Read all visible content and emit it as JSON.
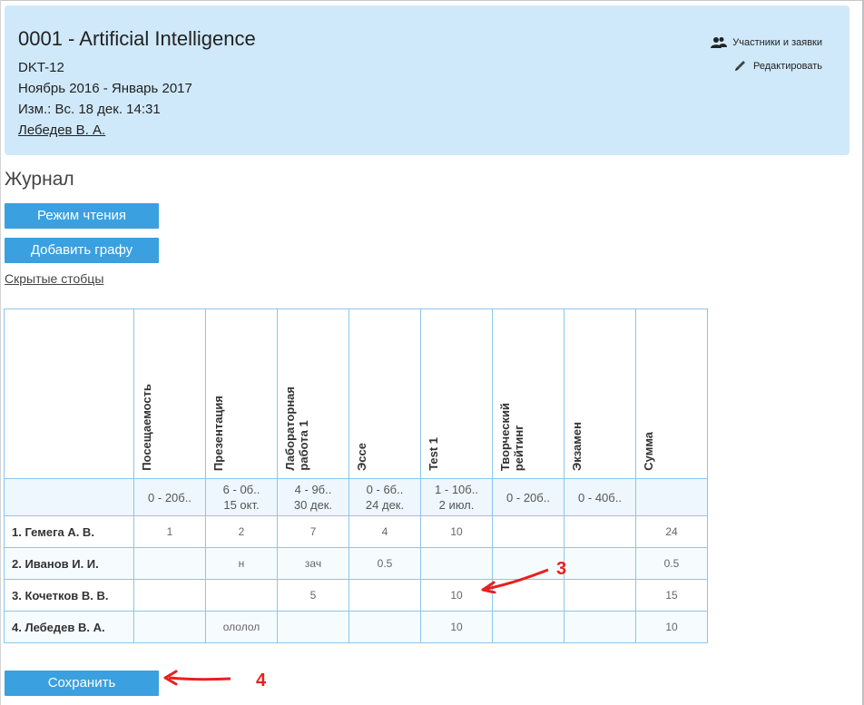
{
  "course": {
    "title": "0001 - Artificial Intelligence",
    "code": "DKT-12",
    "period": "Ноябрь 2016 - Январь 2017",
    "modified": "Изм.: Вс. 18 дек. 14:31",
    "teacher": "Лебедев В. А."
  },
  "actions": {
    "participants": "Участники и заявки",
    "edit": "Редактировать"
  },
  "journal": {
    "title": "Журнал",
    "read_mode": "Режим чтения",
    "add_column": "Добавить графу",
    "hidden_columns": "Скрытые стобцы",
    "save": "Сохранить"
  },
  "table": {
    "columns": [
      "Посещаемость",
      "Презентация",
      "Лабораторная\nработа 1",
      "Эссе",
      "Test 1",
      "Творческий\nрейтинг",
      "Экзамен",
      "Сумма"
    ],
    "ranges": [
      [
        "0 - 20б..",
        ""
      ],
      [
        "6 - 0б..",
        "15 окт."
      ],
      [
        "4 - 9б..",
        "30 дек."
      ],
      [
        "0 - 6б..",
        "24 дек."
      ],
      [
        "1 - 10б..",
        "2 июл."
      ],
      [
        "0 - 20б..",
        ""
      ],
      [
        "0 - 40б..",
        ""
      ],
      [
        "",
        ""
      ]
    ],
    "rows": [
      {
        "name": "1. Гемега А. В.",
        "cells": [
          "1",
          "2",
          "7",
          "4",
          "10",
          "",
          "",
          "24"
        ]
      },
      {
        "name": "2. Иванов И. И.",
        "cells": [
          "",
          "н",
          "зач",
          "0.5",
          "",
          "",
          "",
          "0.5"
        ]
      },
      {
        "name": "3. Кочетков В. В.",
        "cells": [
          "",
          "",
          "5",
          "",
          "10",
          "",
          "",
          "15"
        ]
      },
      {
        "name": "4. Лебедев В. А.",
        "cells": [
          "",
          "ололол",
          "",
          "",
          "10",
          "",
          "",
          "10"
        ]
      }
    ]
  },
  "annotations": {
    "arrow3": "3",
    "arrow4": "4"
  },
  "colors": {
    "header_bg": "#cfe9fa",
    "button": "#3aa0e0",
    "grid_border": "#8cc6ea",
    "annotation": "#e8201e"
  }
}
